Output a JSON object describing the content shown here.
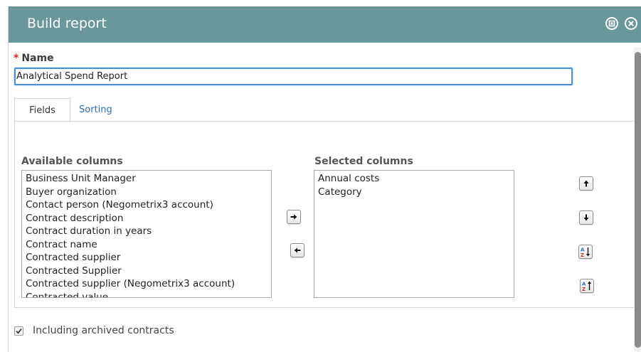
{
  "dialog": {
    "title": "Build report",
    "titlebar_color": "#6a979a",
    "icons": [
      "maximize-icon",
      "close-icon"
    ]
  },
  "name_field": {
    "required_marker": "*",
    "label": "Name",
    "value": "Analytical Spend Report"
  },
  "tabs": [
    {
      "label": "Fields",
      "active": true
    },
    {
      "label": "Sorting",
      "active": false
    }
  ],
  "available_columns": {
    "label": "Available columns",
    "items": [
      "Business Unit Manager",
      "Buyer organization",
      "Contact person (Negometrix3 account)",
      "Contract description",
      "Contract duration in years",
      "Contract name",
      "Contracted supplier",
      "Contracted Supplier",
      "Contracted supplier (Negometrix3 account)",
      "Contracted value"
    ]
  },
  "selected_columns": {
    "label": "Selected columns",
    "items": [
      "Annual costs",
      "Category"
    ]
  },
  "transfer_buttons": [
    "arrow-right-icon",
    "arrow-left-icon"
  ],
  "order_buttons": [
    "arrow-up-icon",
    "arrow-down-icon",
    "sort-ascending-icon",
    "sort-descending-icon"
  ],
  "archived_checkbox": {
    "label": "Including archived contracts",
    "checked": true
  },
  "colors": {
    "accent_focus": "#4a90d9",
    "link": "#2a6ebb",
    "required": "#e02020"
  }
}
